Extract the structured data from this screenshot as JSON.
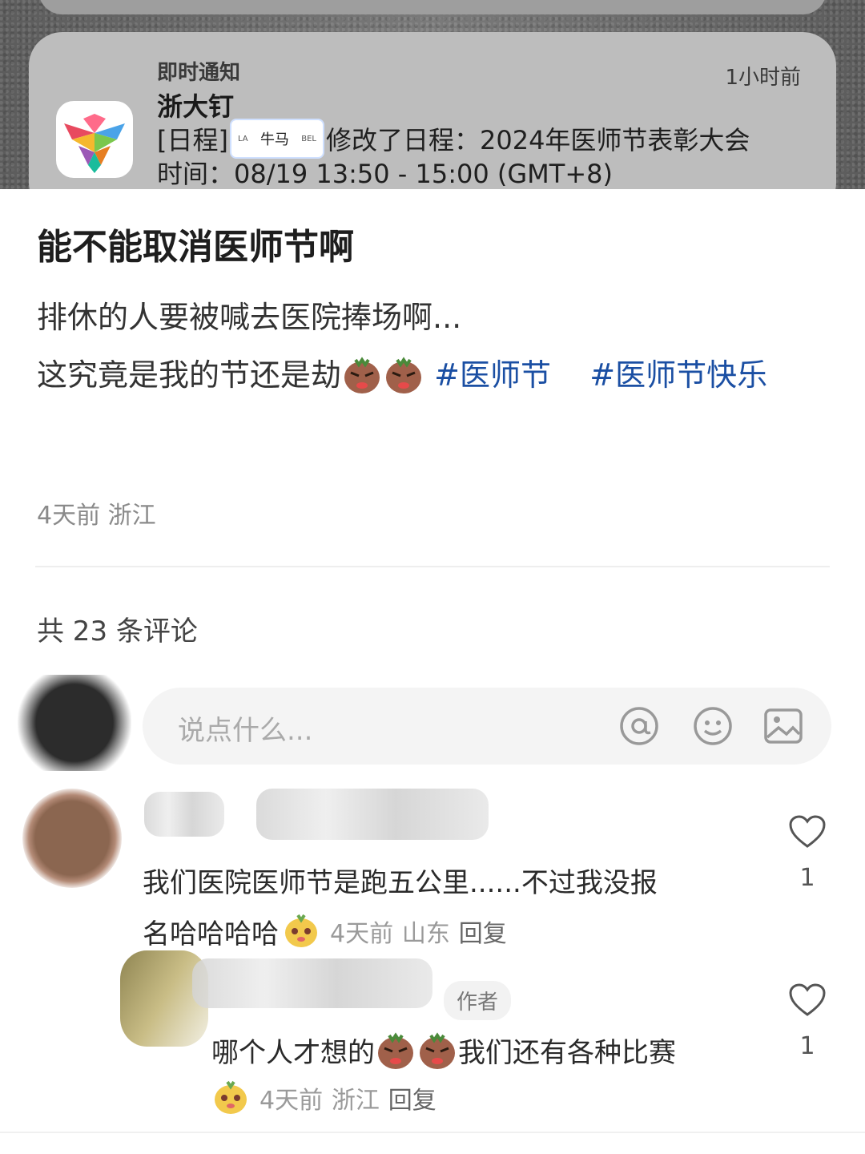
{
  "notification": {
    "type_label": "即时通知",
    "time": "1小时前",
    "app_name": "浙大钉",
    "prefix": "[日程]",
    "chip_center": "牛马",
    "chip_left": "LA",
    "chip_right": "BEL",
    "message": "修改了日程：2024年医师节表彰大会",
    "time_line": "时间：08/19 13:50 - 15:00 (GMT+8)"
  },
  "post": {
    "title": "能不能取消医师节啊",
    "line1": "排休的人要被喊去医院捧场啊...",
    "line2": "这究竟是我的节还是劫",
    "hashtags": [
      "#医师节",
      "#医师节快乐"
    ],
    "meta": "4天前 浙江"
  },
  "comments_header": "共 23 条评论",
  "comment_input": {
    "placeholder": "说点什么...",
    "icons": [
      "at-icon",
      "emoji-icon",
      "image-icon"
    ]
  },
  "comments": [
    {
      "line1": "我们医院医师节是跑五公里......不过我没报",
      "line2": "名哈哈哈哈",
      "time": "4天前",
      "location": "山东",
      "reply_label": "回复",
      "likes": "1"
    },
    {
      "badge": "作者",
      "text_a": "哪个人才想的",
      "text_b": "我们还有各种比赛",
      "time": "4天前",
      "location": "浙江",
      "reply_label": "回复",
      "likes": "1"
    }
  ],
  "colors": {
    "hashtag": "#1b4fa3",
    "meta": "#8a8a8a",
    "background": "#ffffff"
  }
}
